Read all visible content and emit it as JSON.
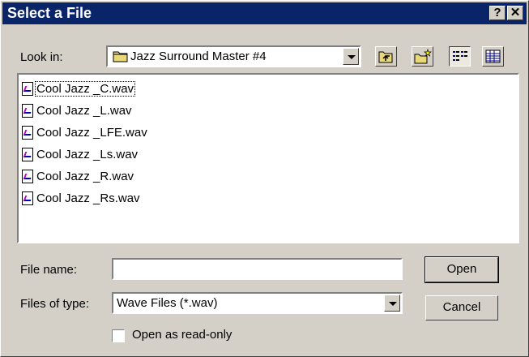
{
  "dialog": {
    "title": "Select a File",
    "help_button": "?",
    "close_button": "✕"
  },
  "look_in": {
    "label": "Look in:",
    "value": "Jazz Surround Master #4"
  },
  "toolbar": {
    "buttons": [
      "up-one-level",
      "create-new-folder",
      "list-view",
      "details-view"
    ],
    "active_view": "list-view"
  },
  "files": [
    {
      "name": "Cool Jazz _C.wav",
      "focused": true
    },
    {
      "name": "Cool Jazz _L.wav"
    },
    {
      "name": "Cool Jazz _LFE.wav"
    },
    {
      "name": "Cool Jazz _Ls.wav"
    },
    {
      "name": "Cool Jazz _R.wav"
    },
    {
      "name": "Cool Jazz _Rs.wav"
    }
  ],
  "file_name": {
    "label": "File name:",
    "value": ""
  },
  "file_type": {
    "label": "Files of type:",
    "value": "Wave Files (*.wav)"
  },
  "read_only": {
    "label": "Open as read-only",
    "checked": false
  },
  "buttons": {
    "open": "Open",
    "cancel": "Cancel"
  },
  "colors": {
    "titlebar": "#0a246a",
    "face": "#d4d0c8"
  }
}
